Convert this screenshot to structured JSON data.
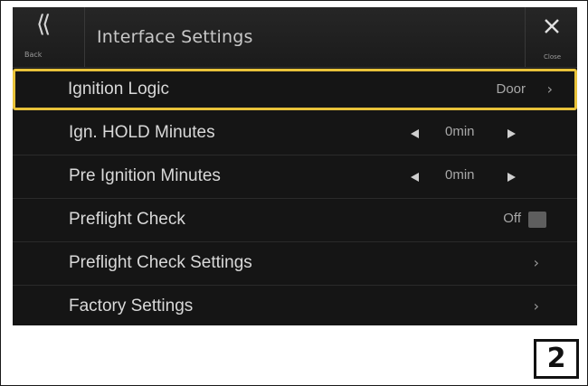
{
  "header": {
    "title": "Interface Settings",
    "back_label": "Back",
    "close_label": "Close"
  },
  "rows": [
    {
      "label": "Ignition Logic",
      "value": "Door"
    },
    {
      "label": "Ign. HOLD Minutes",
      "value": "0min"
    },
    {
      "label": "Pre Ignition Minutes",
      "value": "0min"
    },
    {
      "label": "Preflight Check",
      "value": "Off"
    },
    {
      "label": "Preflight Check Settings"
    },
    {
      "label": "Factory Settings"
    }
  ],
  "page_number": "2",
  "colors": {
    "highlight": "#e8c23a",
    "background": "#151515"
  },
  "icons": {
    "back": "double-chevron-left-icon",
    "close": "close-x-icon",
    "next": "chevron-right-icon",
    "decrement": "triangle-left-icon",
    "increment": "triangle-right-icon"
  }
}
